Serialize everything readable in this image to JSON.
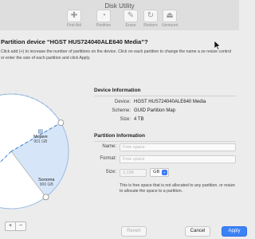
{
  "app": {
    "title": "Disk Utility"
  },
  "toolbar": {
    "items": [
      {
        "label": "First Aid",
        "icon": "stethoscope-icon",
        "glyph": "✚"
      },
      {
        "label": "Partition",
        "icon": "partition-icon",
        "glyph": "◔"
      },
      {
        "label": "Erase",
        "icon": "erase-icon",
        "glyph": "✎"
      },
      {
        "label": "Restore",
        "icon": "restore-icon",
        "glyph": "↻"
      },
      {
        "label": "Unmount",
        "icon": "unmount-icon",
        "glyph": "⏏"
      }
    ]
  },
  "sheet": {
    "title": "Partition device “HGST HUS724040ALE640 Media”?",
    "instructions": "Click add (+) to increase the number of partitions on the device. Click on each partition to change the name a ze resize control or enter the size of each partition and click Apply."
  },
  "pie": {
    "volumes": [
      {
        "name": "Mojave",
        "size": "901 GB",
        "fraction": 0.23,
        "color": "#d6e5f8",
        "icon": "file-icon"
      },
      {
        "name": "Sonoma",
        "size": "900 GB",
        "fraction": 0.23,
        "color": "#ffffff"
      },
      {
        "name": "",
        "size": "",
        "fraction": 0.54,
        "color": "#3f93e4",
        "selected": true
      }
    ],
    "add_label": "+",
    "remove_label": "−"
  },
  "device_info": {
    "title": "Device Information",
    "rows": [
      {
        "key": "Device:",
        "value": "HGST HUS724040ALE640 Media"
      },
      {
        "key": "Scheme:",
        "value": "GUID Partition Map"
      },
      {
        "key": "Size:",
        "value": "4 TB"
      }
    ]
  },
  "partition_info": {
    "title": "Partition Information",
    "name_label": "Name:",
    "name_placeholder": "Free space",
    "format_label": "Format:",
    "format_placeholder": "Free space",
    "size_label": "Size:",
    "size_value": "2,198",
    "unit": "GB",
    "note": "This is free space that is not allocated to any partition. or resize to allocate the space to a partition."
  },
  "buttons": {
    "revert": "Revert",
    "cancel": "Cancel",
    "apply": "Apply"
  }
}
